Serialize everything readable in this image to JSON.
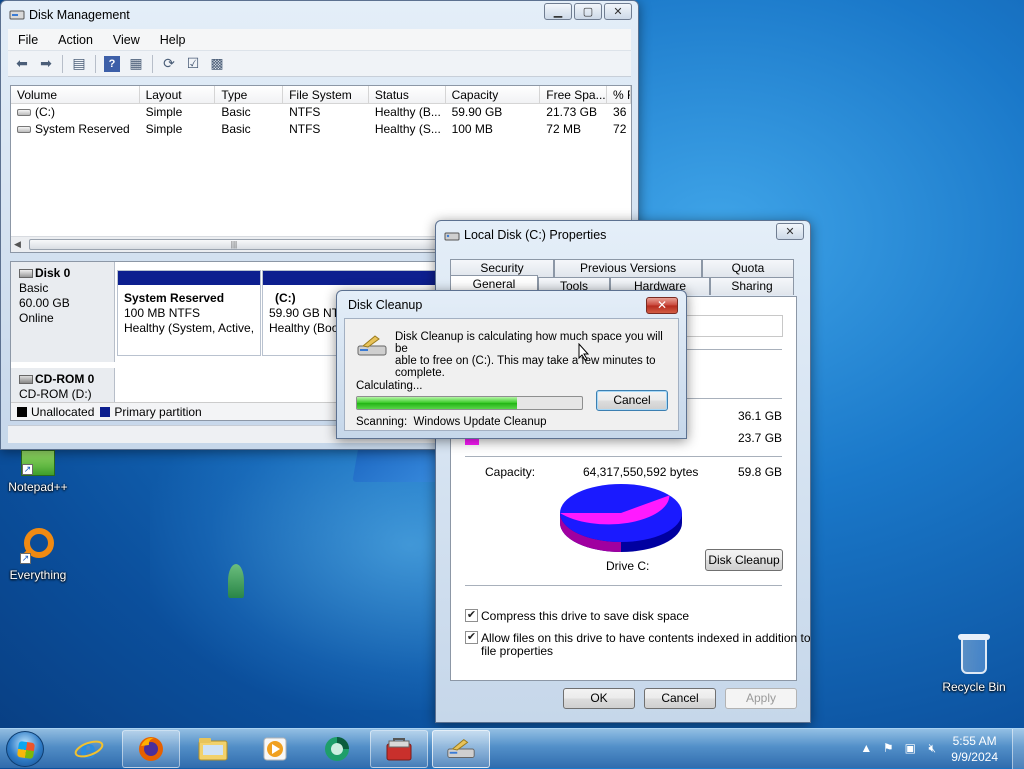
{
  "desktop": {
    "icons": {
      "notepad": "Notepad++",
      "everything": "Everything",
      "recycle": "Recycle Bin"
    }
  },
  "disk_management": {
    "title": "Disk Management",
    "menu": [
      "File",
      "Action",
      "View",
      "Help"
    ],
    "columns": [
      "Volume",
      "Layout",
      "Type",
      "File System",
      "Status",
      "Capacity",
      "Free Spa...",
      "% F"
    ],
    "rows": [
      [
        "(C:)",
        "Simple",
        "Basic",
        "NTFS",
        "Healthy (B...",
        "59.90 GB",
        "21.73 GB",
        "36"
      ],
      [
        "System Reserved",
        "Simple",
        "Basic",
        "NTFS",
        "Healthy (S...",
        "100 MB",
        "72 MB",
        "72"
      ]
    ],
    "disk0": {
      "name": "Disk 0",
      "type": "Basic",
      "size": "60.00 GB",
      "state": "Online"
    },
    "partitions": [
      {
        "name": "System Reserved",
        "size": "100 MB NTFS",
        "status": "Healthy (System, Active,"
      },
      {
        "name": "(C:)",
        "size": "59.90 GB NTF",
        "status": "Healthy (Boo"
      }
    ],
    "cdrom": {
      "name": "CD-ROM 0",
      "drive": "CD-ROM (D:)"
    },
    "legend": [
      "Unallocated",
      "Primary partition"
    ],
    "colors": {
      "unallocated": "#000000",
      "primary": "#0d1f8f"
    }
  },
  "properties": {
    "title": "Local Disk (C:) Properties",
    "tabs_top": [
      "Security",
      "Previous Versions",
      "Quota"
    ],
    "tabs_bottom": [
      "General",
      "Tools",
      "Hardware",
      "Sharing"
    ],
    "used_value": "36.1 GB",
    "free_value": "23.7 GB",
    "capacity_label": "Capacity:",
    "capacity_bytes": "64,317,550,592 bytes",
    "capacity_gb": "59.8 GB",
    "drive_label": "Drive C:",
    "disk_cleanup_button": "Disk Cleanup",
    "compress_label": "Compress this drive to save disk space",
    "index_label_1": "Allow files on this drive to have contents indexed in addition to",
    "index_label_2": "file properties",
    "ok": "OK",
    "cancel": "Cancel",
    "apply": "Apply",
    "used_fraction": 0.604,
    "colors": {
      "used": "#1a1aff",
      "free": "#ff1aff"
    }
  },
  "cleanup": {
    "title": "Disk Cleanup",
    "message_1": "Disk Cleanup is calculating how much space you will be",
    "message_2": "able to free on  (C:). This may take a few minutes to",
    "message_3": "complete.",
    "calculating": "Calculating...",
    "cancel": "Cancel",
    "scanning_label": "Scanning:",
    "scanning_item": "Windows Update Cleanup",
    "progress_percent": 71
  },
  "taskbar": {
    "time": "5:55 AM",
    "date": "9/9/2024"
  }
}
